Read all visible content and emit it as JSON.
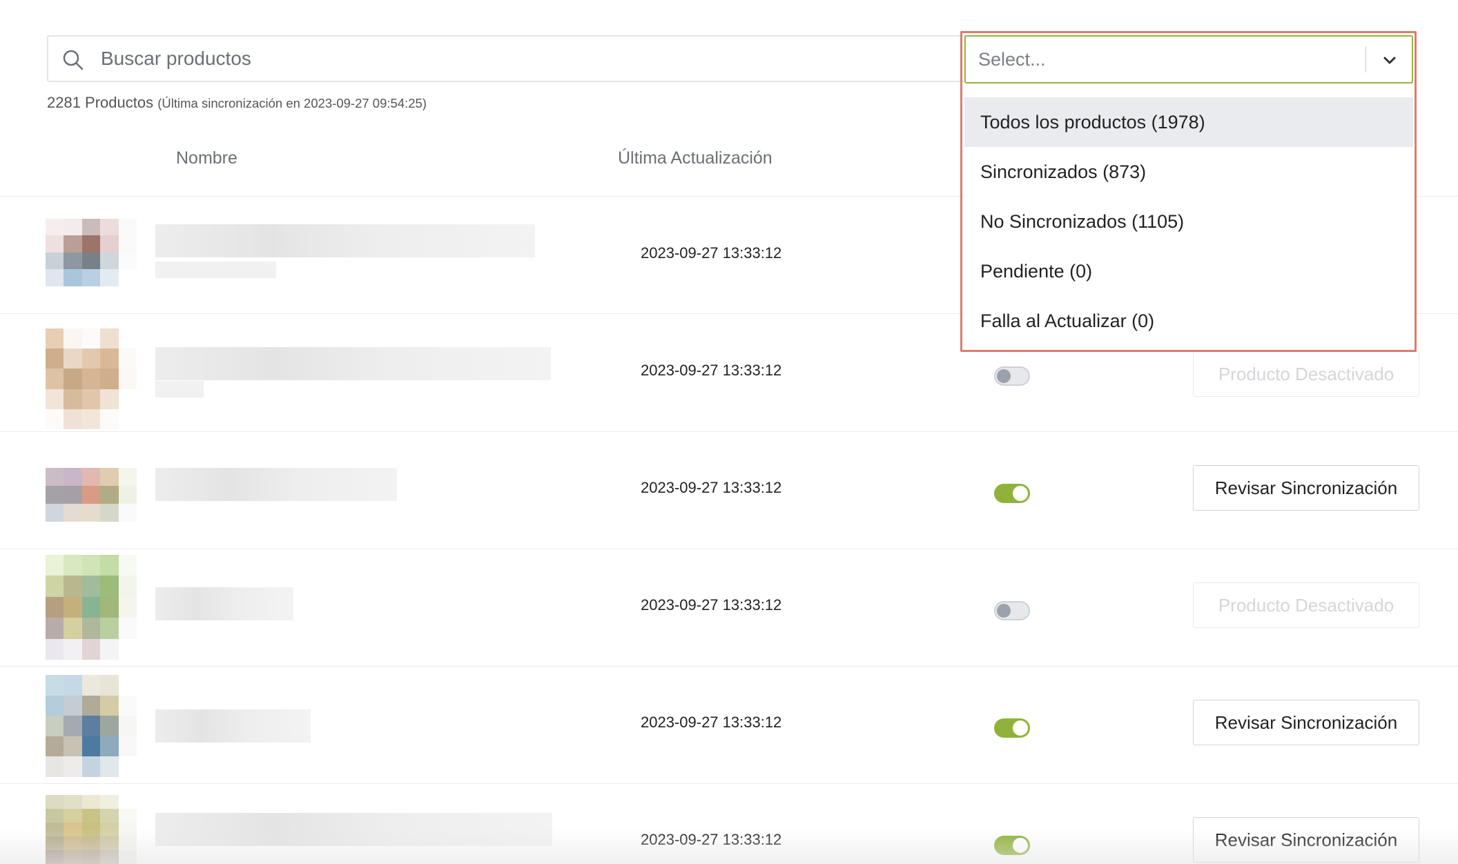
{
  "search": {
    "placeholder": "Buscar productos",
    "value": ""
  },
  "summary": {
    "count": "2281 Productos",
    "sync_note": "(Última sincronización en 2023-09-27 09:54:25)"
  },
  "table": {
    "headers": {
      "name": "Nombre",
      "updated": "Última Actualización"
    },
    "rows": [
      {
        "date": "2023-09-27 13:33:12",
        "synced": null,
        "action": ""
      },
      {
        "date": "2023-09-27 13:33:12",
        "synced": false,
        "action": "Producto Desactivado"
      },
      {
        "date": "2023-09-27 13:33:12",
        "synced": true,
        "action": "Revisar Sincronización"
      },
      {
        "date": "2023-09-27 13:33:12",
        "synced": false,
        "action": "Producto Desactivado"
      },
      {
        "date": "2023-09-27 13:33:12",
        "synced": true,
        "action": "Revisar Sincronización"
      },
      {
        "date": "2023-09-27 13:33:12",
        "synced": true,
        "action": "Revisar Sincronización"
      }
    ]
  },
  "filter_select": {
    "placeholder": "Select...",
    "options": [
      "Todos los productos (1978)",
      "Sincronizados (873)",
      "No Sincronizados (1105)",
      "Pendiente (0)",
      "Falla al Actualizar (0)"
    ],
    "highlighted_index": 0
  },
  "colors": {
    "accent_green": "#8fb33a",
    "focus_border": "#96b43a",
    "annotation_red": "#e07a6c"
  }
}
